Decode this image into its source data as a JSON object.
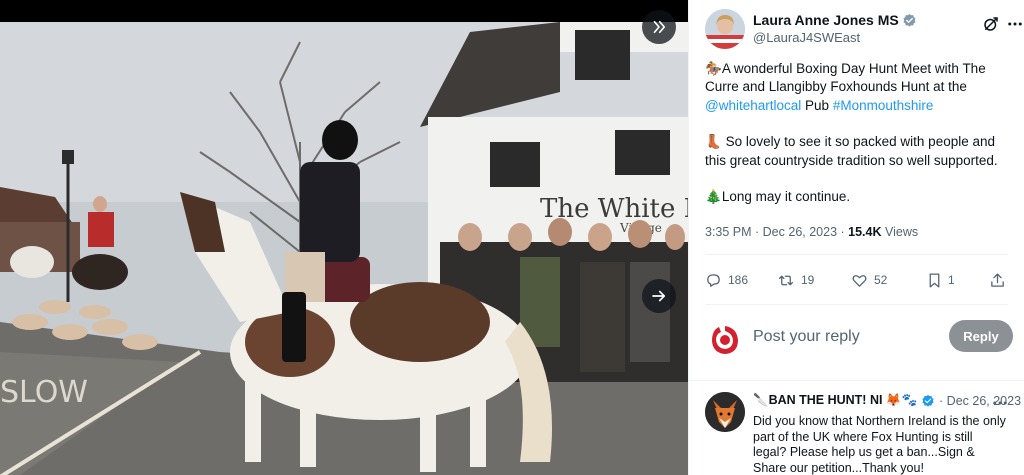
{
  "author": {
    "name": "Laura Anne Jones MS",
    "handle": "@LauraJ4SWEast"
  },
  "tweet": {
    "para1_emoji": "🏇",
    "para1_text": "A wonderful Boxing Day Hunt Meet with The Curre and Llangibby Foxhounds Hunt at the",
    "mention": "@whitehartlocal",
    "para1_mid": "Pub",
    "hashtag": "#Monmouthshire",
    "para2_emoji": "👢",
    "para2_text": "So lovely to see it so packed with people and this great countryside tradition so well supported.",
    "para3_emoji": "🎄",
    "para3_text": "Long may it continue."
  },
  "meta": {
    "time": "3:35 PM · Dec 26, 2023 · ",
    "views_count": "15.4K",
    "views_label": "Views"
  },
  "actions": {
    "replies": "186",
    "reposts": "19",
    "likes": "52",
    "bookmarks": "1"
  },
  "composer": {
    "placeholder": "Post your reply",
    "button": "Reply"
  },
  "reply": {
    "name": "🔪BAN THE HUNT! NI 🦊🐾",
    "date": "· Dec 26, 2023",
    "text": "Did you know that Northern Ireland is the only part of the UK where Fox Hunting is still legal? Please help us get a ban...Sign & Share our petition...Thank you!"
  },
  "photo": {
    "sign_text": "The White Ha",
    "sign_sub": "Village",
    "road_marking": "SLOW"
  },
  "colors": {
    "accent": "#1d9bf0",
    "text": "#0f1419",
    "muted": "#536471",
    "reply_button": "#8c9196"
  }
}
